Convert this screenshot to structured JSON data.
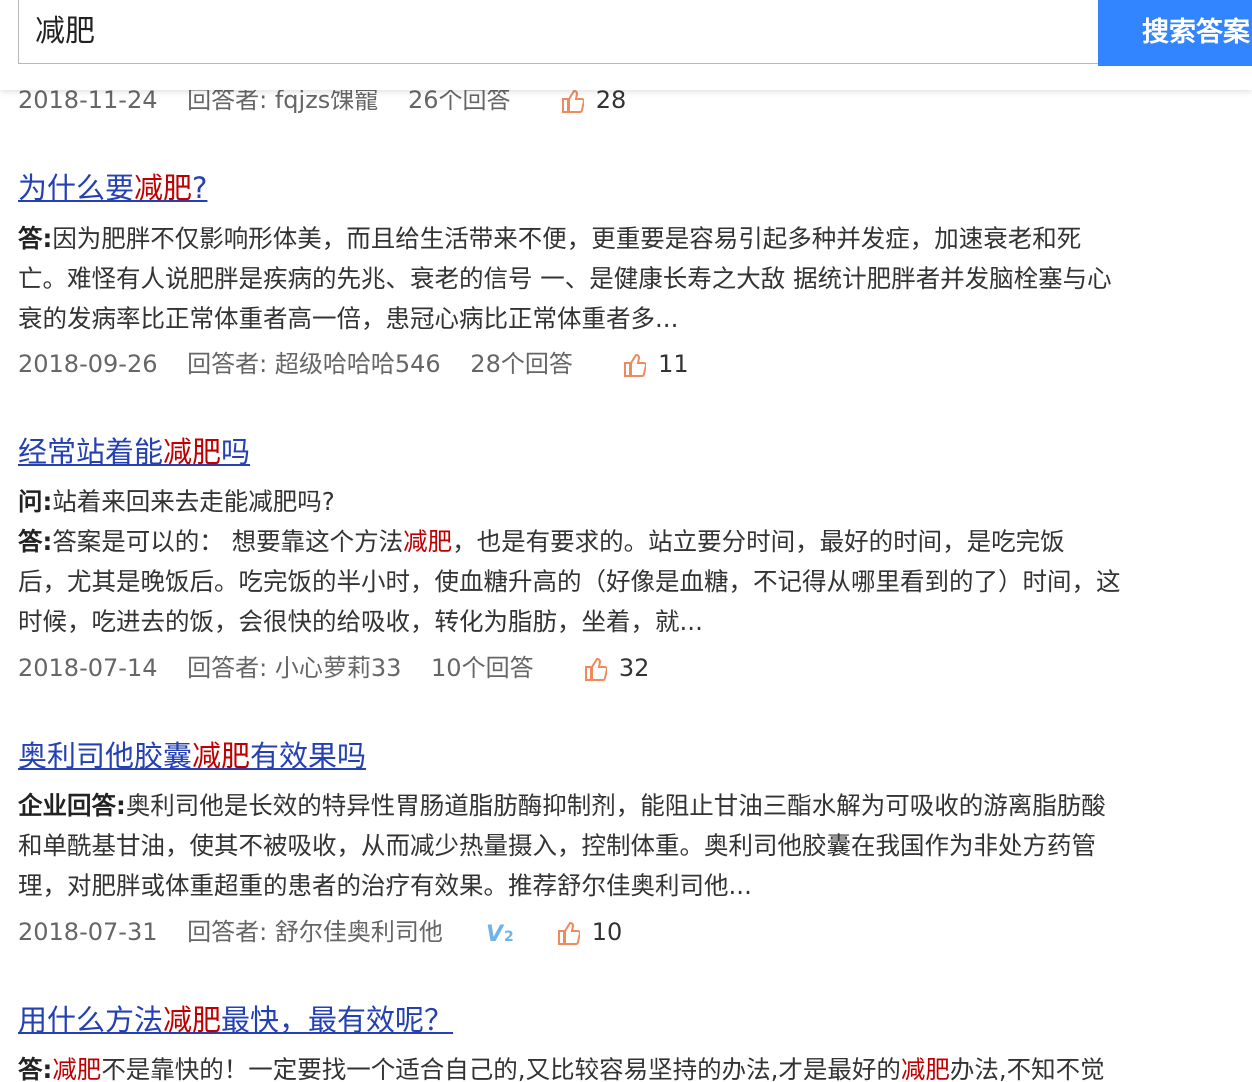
{
  "search": {
    "query": "减肥",
    "button_label": "搜索答案"
  },
  "results": [
    {
      "meta": {
        "date": "2018-11-24",
        "answerer": "回答者: fqjzs馃寵",
        "answers": "26个回答",
        "likes": "28"
      }
    },
    {
      "title": {
        "part1": "为什么要",
        "hl": "减肥",
        "part2": "?"
      },
      "answer_label": "答:",
      "answer_lines": [
        "因为肥胖不仅影响形体美，而且给生活带来不便，更重要是容易引起多种并发症，加速衰老和死",
        "亡。难怪有人说肥胖是疾病的先兆、衰老的信号 一、是健康长寿之大敌 据统计肥胖者并发脑栓塞与心",
        "衰的发病率比正常体重者高一倍，患冠心病比正常体重者多..."
      ],
      "meta": {
        "date": "2018-09-26",
        "answerer": "回答者: 超级哈哈哈546",
        "answers": "28个回答",
        "likes": "11"
      }
    },
    {
      "title": {
        "part1": "经常站着能",
        "hl": "减肥",
        "part2": "吗"
      },
      "question_label": "问:",
      "question": "站着来回来去走能减肥吗?",
      "answer_label": "答:",
      "answer_line1_a": "答案是可以的： 想要靠这个方法",
      "answer_line1_hl": "减肥",
      "answer_line1_b": "，也是有要求的。站立要分时间，最好的时间，是吃完饭",
      "answer_lines": [
        "后，尤其是晚饭后。吃完饭的半小时，使血糖升高的（好像是血糖，不记得从哪里看到的了）时间，这",
        "时候，吃进去的饭，会很快的给吸收，转化为脂肪，坐着，就..."
      ],
      "meta": {
        "date": "2018-07-14",
        "answerer": "回答者: 小心萝莉33",
        "answers": "10个回答",
        "likes": "32"
      }
    },
    {
      "title": {
        "part1": "奥利司他胶囊",
        "hl": "减肥",
        "part2": "有效果吗"
      },
      "answer_label": "企业回答:",
      "answer_lines": [
        "奥利司他是长效的特异性胃肠道脂肪酶抑制剂，能阻止甘油三酯水解为可吸收的游离脂肪酸",
        "和单酰基甘油，使其不被吸收，从而减少热量摄入，控制体重。奥利司他胶囊在我国作为非处方药管",
        "理，对肥胖或体重超重的患者的治疗有效果。推荐舒尔佳奥利司他..."
      ],
      "meta": {
        "date": "2018-07-31",
        "answerer": "回答者: 舒尔佳奥利司他",
        "likes": "10"
      }
    },
    {
      "title": {
        "part1": "用什么方法",
        "hl": "减肥",
        "part2": "最快，最有效呢？"
      },
      "answer_label": "答:",
      "answer_a": "",
      "answer_hl1": "减肥",
      "answer_b": "不是靠快的！一定要找一个适合自己的,又比较容易坚持的办法,才是最好的",
      "answer_hl2": "减肥",
      "answer_c": "办法,不知不觉"
    }
  ],
  "colors": {
    "link": "#2440b3",
    "highlight": "#c00000",
    "search_button": "#3385ff",
    "meta_text": "#666666",
    "thumb_icon": "#f08a5d"
  }
}
